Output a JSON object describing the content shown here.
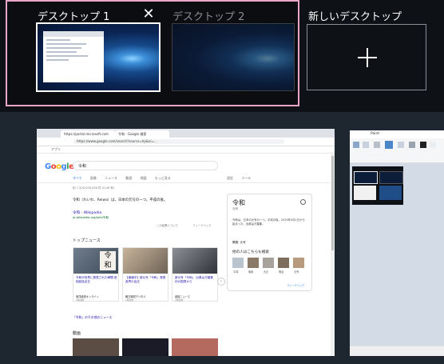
{
  "desktops": [
    {
      "label": "デスクトップ 1",
      "active": true
    },
    {
      "label": "デスクトップ 2",
      "active": false
    }
  ],
  "new_desktop_label": "新しいデスクトップ",
  "close_glyph": "✕",
  "plus_icon": "plus-icon",
  "browser": {
    "tabs": [
      "https://portal.microsoft.com",
      "令和 - Google 検索"
    ],
    "address": "https://www.google.com/search?source=hp&ei=…",
    "bookmark_label": "アプリ",
    "search_query": "令和",
    "search_tabs": [
      "すべて",
      "画像",
      "ニュース",
      "動画",
      "地図",
      "もっと見る",
      "設定",
      "ツール"
    ],
    "result_count": "約 7,320,000,000 件 (0.49 秒)",
    "snippet": "令和（れいわ、Reiwa）は、日本の元号の一つ。平成の後。",
    "snippet_link": "令和 - Wikipedia",
    "snippet_url": "ja.wikipedia.org/wiki/令和",
    "feedback_left": "この結果について",
    "feedback_right": "フィードバック",
    "kp_title": "令和",
    "kp_sub": "元号",
    "kp_body": "令和は、日本の元号の一つ。平成の後。2019年5月1日から始まった。出典は万葉集。",
    "kp_usage": "関連: 元号",
    "kp_others": "他の人はこちらも検索",
    "kp_items": [
      "平成",
      "昭和",
      "大正",
      "明治",
      "元号"
    ],
    "kp_more": "フィードバック",
    "top_news": "トップニュース",
    "news": [
      {
        "text": "令和が世界に発表された瞬間 首相談話全文",
        "src": "東洋経済オンライン",
        "time": "1時間前"
      },
      {
        "text": "【速報中】新元号「令和」発表 各界の反応",
        "src": "朝日新聞デジタル",
        "time": "1時間前"
      },
      {
        "text": "新元号「令和」 出典は万葉集 初の国書から",
        "src": "産経ニュース",
        "time": "1時間前"
      }
    ],
    "more_news": "「令和」のその他のニュース",
    "videos_head": "動画"
  },
  "paint": {
    "title": "Paint"
  }
}
